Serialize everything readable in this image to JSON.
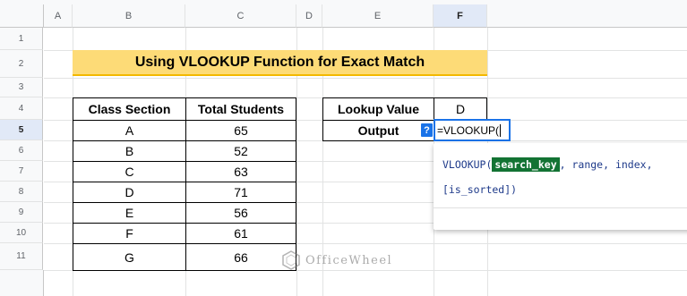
{
  "columns": [
    "A",
    "B",
    "C",
    "D",
    "E",
    "F"
  ],
  "rows": [
    "1",
    "2",
    "3",
    "4",
    "5",
    "6",
    "7",
    "8",
    "9",
    "10",
    "11"
  ],
  "title": "Using VLOOKUP Function for Exact Match",
  "table": {
    "headers": [
      "Class Section",
      "Total Students"
    ],
    "rows": [
      [
        "A",
        "65"
      ],
      [
        "B",
        "52"
      ],
      [
        "C",
        "63"
      ],
      [
        "D",
        "71"
      ],
      [
        "E",
        "56"
      ],
      [
        "F",
        "61"
      ],
      [
        "G",
        "66"
      ]
    ]
  },
  "lookup": {
    "label": "Lookup Value",
    "value": "D",
    "output_label": "Output",
    "formula": "=VLOOKUP("
  },
  "help_badge": "?",
  "tooltip": {
    "fn": "VLOOKUP(",
    "arg_highlight": "search_key",
    "rest": ", range, index,",
    "line2": "[is_sorted])"
  },
  "watermark": "OfficeWheel",
  "colors": {
    "title_bg": "#fddb77",
    "accent": "#1a73e8",
    "highlight": "#137333"
  }
}
